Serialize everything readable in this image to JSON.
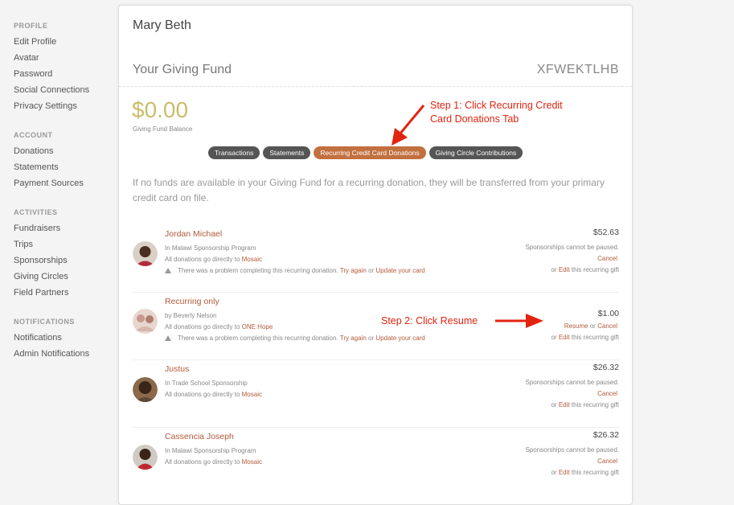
{
  "sidebar": {
    "sections": [
      {
        "title": "PROFILE",
        "items": [
          "Edit Profile",
          "Avatar",
          "Password",
          "Social Connections",
          "Privacy Settings"
        ]
      },
      {
        "title": "ACCOUNT",
        "items": [
          "Donations",
          "Statements",
          "Payment Sources"
        ]
      },
      {
        "title": "ACTIVITIES",
        "items": [
          "Fundraisers",
          "Trips",
          "Sponsorships",
          "Giving Circles",
          "Field Partners"
        ]
      },
      {
        "title": "NOTIFICATIONS",
        "items": [
          "Notifications",
          "Admin Notifications"
        ]
      }
    ]
  },
  "card": {
    "user_name": "Mary Beth",
    "fund_title": "Your Giving Fund",
    "fund_code": "XFWEKTLHB",
    "balance": "$0.00",
    "balance_label": "Giving Fund Balance",
    "tabs": [
      "Transactions",
      "Statements",
      "Recurring Credit Card Donations",
      "Giving Circle Contributions"
    ],
    "info": "If no funds are available in your Giving Fund for a recurring donation, they will be transferred from your primary credit card on file."
  },
  "annotations": {
    "step1_line1": "Step 1: Click Recurring Credit",
    "step1_line2": "Card Donations Tab",
    "step2": "Step 2: Click Resume"
  },
  "donations": [
    {
      "name": "Jordan Michael",
      "program": "In Malawi Sponsorship Program",
      "direct_text": "All donations go directly to",
      "org": "Mosaic",
      "warning": "There was a problem completing this recurring donation.",
      "try_again": "Try again",
      "or": "or",
      "update_card": "Update your card",
      "amount": "$52.63",
      "status": "Sponsorships cannot be paused.",
      "resume": "",
      "cancel": "Cancel",
      "edit_prefix": "or",
      "edit": "Edit",
      "edit_suffix": "this recurring gift"
    },
    {
      "name": "Recurring only",
      "program": "by Beverly Nelson",
      "direct_text": "All donations go directly to",
      "org": "ONE Hope",
      "warning": "There was a problem completing this recurring donation.",
      "try_again": "Try again",
      "or": "or",
      "update_card": "Update your card",
      "amount": "$1.00",
      "status": "",
      "resume": "Resume",
      "cancel": "Cancel",
      "edit_prefix": "or",
      "edit": "Edit",
      "edit_suffix": "this recurring gift"
    },
    {
      "name": "Justus",
      "program": "In Trade School Sponsorship",
      "direct_text": "All donations go directly to",
      "org": "Mosaic",
      "amount": "$26.32",
      "status": "Sponsorships cannot be paused.",
      "cancel": "Cancel",
      "edit_prefix": "or",
      "edit": "Edit",
      "edit_suffix": "this recurring gift"
    },
    {
      "name": "Cassencia Joseph",
      "program": "In Malawi Sponsorship Program",
      "direct_text": "All donations go directly to",
      "org": "Mosaic",
      "amount": "$26.32",
      "status": "Sponsorships cannot be paused.",
      "cancel": "Cancel",
      "edit_prefix": "or",
      "edit": "Edit",
      "edit_suffix": "this recurring gift"
    }
  ],
  "colors": {
    "accent": "#b35a3a",
    "tab_active": "#c2703f",
    "tab": "#555555",
    "balance": "#cbbd6a",
    "annotation": "#e02410"
  }
}
